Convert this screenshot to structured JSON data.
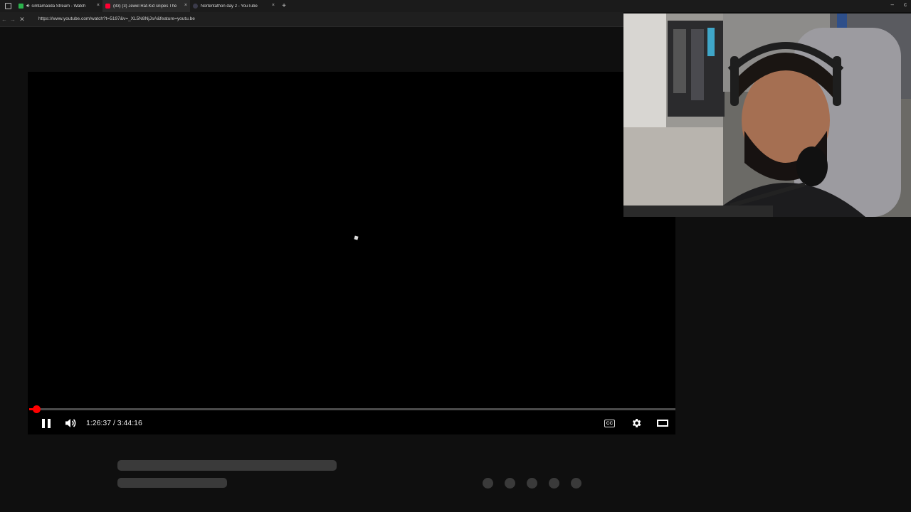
{
  "tabs": [
    {
      "title": "simtamaoda Stream - Watch",
      "favicon": "green-square-icon",
      "audio": true,
      "active": false
    },
    {
      "title": "(83) (3) Jewel Rat-Kid snipes The",
      "favicon": "youtube-icon",
      "audio": false,
      "active": true
    },
    {
      "title": "Nortentathon day 2 - YouTube",
      "favicon": "generic-page-icon",
      "audio": false,
      "active": false
    }
  ],
  "tab_close_glyph": "×",
  "new_tab_glyph": "+",
  "address_bar": {
    "url": "https://www.youtube.com/watch?t=5197&v=_XL5N8NjJsA&feature=youtu.be"
  },
  "player": {
    "state": "playing",
    "current_time": "1:26:37",
    "duration": "3:44:16",
    "time_display": "1:26:37 / 3:44:16",
    "progress": 0.0105,
    "cc_label": "CC",
    "accent_color": "#ff0000"
  },
  "icons": {
    "pause": "pause-icon",
    "volume": "volume-icon",
    "captions": "captions-icon",
    "settings": "gear-icon",
    "theater": "theater-mode-icon"
  },
  "webcam": {
    "description_icon": "webcam-overlay"
  }
}
